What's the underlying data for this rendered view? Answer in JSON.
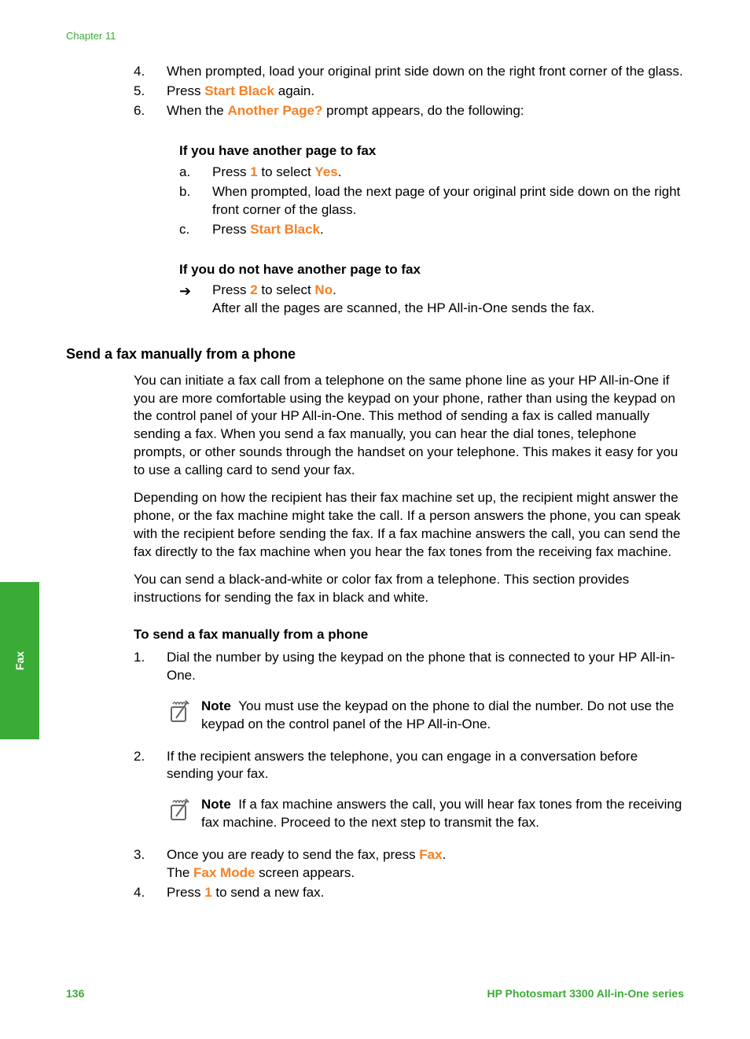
{
  "header": {
    "chapter": "Chapter 11"
  },
  "sidetab": {
    "label": "Fax"
  },
  "footer": {
    "page": "136",
    "product": "HP Photosmart 3300 All-in-One series"
  },
  "top_steps": {
    "s4": {
      "num": "4.",
      "text": "When prompted, load your original print side down on the right front corner of the glass."
    },
    "s5": {
      "num": "5.",
      "pre": "Press ",
      "btn": "Start Black",
      "post": " again."
    },
    "s6": {
      "num": "6.",
      "pre": "When the ",
      "btn": "Another Page?",
      "post": " prompt appears, do the following:"
    }
  },
  "another_yes": {
    "title": "If you have another page to fax",
    "a": {
      "num": "a.",
      "pre": "Press ",
      "n": "1",
      "mid": " to select ",
      "opt": "Yes",
      "post": "."
    },
    "b": {
      "num": "b.",
      "text": "When prompted, load the next page of your original print side down on the right front corner of the glass."
    },
    "c": {
      "num": "c.",
      "pre": "Press ",
      "btn": "Start Black",
      "post": "."
    }
  },
  "another_no": {
    "title": "If you do not have another page to fax",
    "arrow": "➔",
    "press": {
      "pre": "Press ",
      "n": "2",
      "mid": " to select ",
      "opt": "No",
      "post": "."
    },
    "after": "After all the pages are scanned, the HP All-in-One sends the fax."
  },
  "section": {
    "title": "Send a fax manually from a phone"
  },
  "para1": "You can initiate a fax call from a telephone on the same phone line as your HP All-in-One if you are more comfortable using the keypad on your phone, rather than using the keypad on the control panel of your HP All-in-One. This method of sending a fax is called manually sending a fax. When you send a fax manually, you can hear the dial tones, telephone prompts, or other sounds through the handset on your telephone. This makes it easy for you to use a calling card to send your fax.",
  "para2": "Depending on how the recipient has their fax machine set up, the recipient might answer the phone, or the fax machine might take the call. If a person answers the phone, you can speak with the recipient before sending the fax. If a fax machine answers the call, you can send the fax directly to the fax machine when you hear the fax tones from the receiving fax machine.",
  "para3": "You can send a black-and-white or color fax from a telephone. This section provides instructions for sending the fax in black and white.",
  "subhead": "To send a fax manually from a phone",
  "steps": {
    "s1": {
      "num": "1.",
      "text": "Dial the number by using the keypad on the phone that is connected to your HP All-in-One."
    },
    "note1": {
      "label": "Note",
      "text": "You must use the keypad on the phone to dial the number. Do not use the keypad on the control panel of the HP All-in-One."
    },
    "s2": {
      "num": "2.",
      "text": "If the recipient answers the telephone, you can engage in a conversation before sending your fax."
    },
    "note2": {
      "label": "Note",
      "text": "If a fax machine answers the call, you will hear fax tones from the receiving fax machine. Proceed to the next step to transmit the fax."
    },
    "s3": {
      "num": "3.",
      "line1": {
        "pre": "Once you are ready to send the fax, press ",
        "btn": "Fax",
        "post": "."
      },
      "line2": {
        "pre": "The ",
        "btn": "Fax Mode",
        "post": " screen appears."
      }
    },
    "s4": {
      "num": "4.",
      "pre": "Press ",
      "n": "1",
      "post": " to send a new fax."
    }
  }
}
